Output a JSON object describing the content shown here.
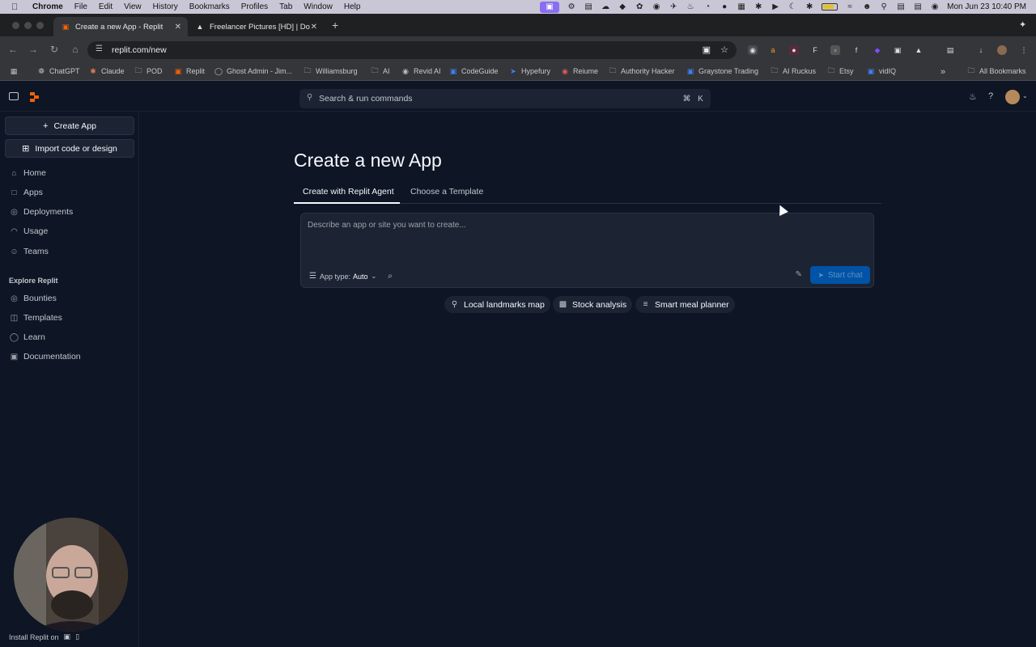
{
  "menubar": {
    "app": "Chrome",
    "items": [
      "File",
      "Edit",
      "View",
      "History",
      "Bookmarks",
      "Profiles",
      "Tab",
      "Window",
      "Help"
    ],
    "clock": "Mon Jun 23  10:40 PM"
  },
  "tabs": [
    {
      "title": "Create a new App - Replit",
      "active": true
    },
    {
      "title": "Freelancer Pictures [HD] | Do",
      "active": false
    }
  ],
  "omnibox": {
    "url": "replit.com/new"
  },
  "bookmarks": {
    "items": [
      "ChatGPT",
      "Claude",
      "POD",
      "Replit",
      "Ghost Admin - Jim...",
      "Williamsburg",
      "AI",
      "Revid AI",
      "CodeGuide",
      "Hypefury",
      "Reiume",
      "Authority Hacker",
      "Graystone Trading",
      "AI Ruckus",
      "Etsy",
      "vidIQ"
    ],
    "overflow": "»",
    "all": "All Bookmarks"
  },
  "header": {
    "search_placeholder": "Search & run commands",
    "kbd_cmd": "⌘",
    "kbd_k": "K"
  },
  "sidebar": {
    "create_app": "Create App",
    "import": "Import code or design",
    "nav": [
      {
        "label": "Home",
        "icon": "home-icon"
      },
      {
        "label": "Apps",
        "icon": "folder-icon"
      },
      {
        "label": "Deployments",
        "icon": "globe-icon"
      },
      {
        "label": "Usage",
        "icon": "gauge-icon"
      },
      {
        "label": "Teams",
        "icon": "people-icon"
      }
    ],
    "explore_label": "Explore Replit",
    "explore": [
      {
        "label": "Bounties",
        "icon": "target-icon"
      },
      {
        "label": "Templates",
        "icon": "template-icon"
      },
      {
        "label": "Learn",
        "icon": "bulb-icon"
      },
      {
        "label": "Documentation",
        "icon": "book-icon"
      }
    ],
    "install": "Install Replit on"
  },
  "main": {
    "title": "Create a new App",
    "tabs": [
      "Create with Replit Agent",
      "Choose a Template"
    ],
    "prompt_placeholder": "Describe an app or site you want to create...",
    "app_type_label": "App type:",
    "app_type_value": "Auto",
    "start_chat": "Start chat",
    "suggestions": [
      {
        "label": "Local landmarks map",
        "icon": "pin-icon"
      },
      {
        "label": "Stock analysis",
        "icon": "bar-chart-icon"
      },
      {
        "label": "Smart meal planner",
        "icon": "checklist-icon"
      }
    ]
  },
  "colors": {
    "background": "#0e1525",
    "surface": "#1c2333",
    "accent": "#0053a6",
    "brand": "#f26207"
  }
}
